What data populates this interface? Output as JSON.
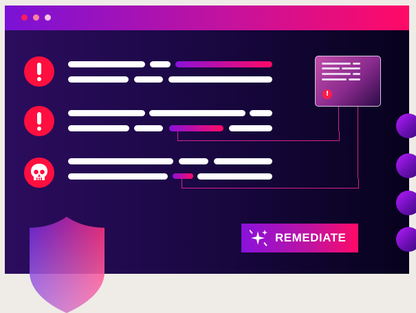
{
  "window": {
    "controls": [
      "close",
      "minimize",
      "maximize"
    ]
  },
  "issues": [
    {
      "icon": "exclamation-icon",
      "severity": "alert"
    },
    {
      "icon": "exclamation-icon",
      "severity": "alert"
    },
    {
      "icon": "skull-icon",
      "severity": "critical"
    }
  ],
  "popup": {
    "icon": "warning-icon"
  },
  "remediate_button": {
    "label": "REMEDIATE",
    "icon": "sparkle-icon"
  },
  "decorations": {
    "side_circles": 4,
    "shield": "shield-icon"
  },
  "colors": {
    "accent_pink": "#ff0a66",
    "accent_purple": "#8a12d8",
    "alert_red": "#ff0f3f",
    "window_bg": "#1b0845",
    "page_bg": "#efece7"
  }
}
